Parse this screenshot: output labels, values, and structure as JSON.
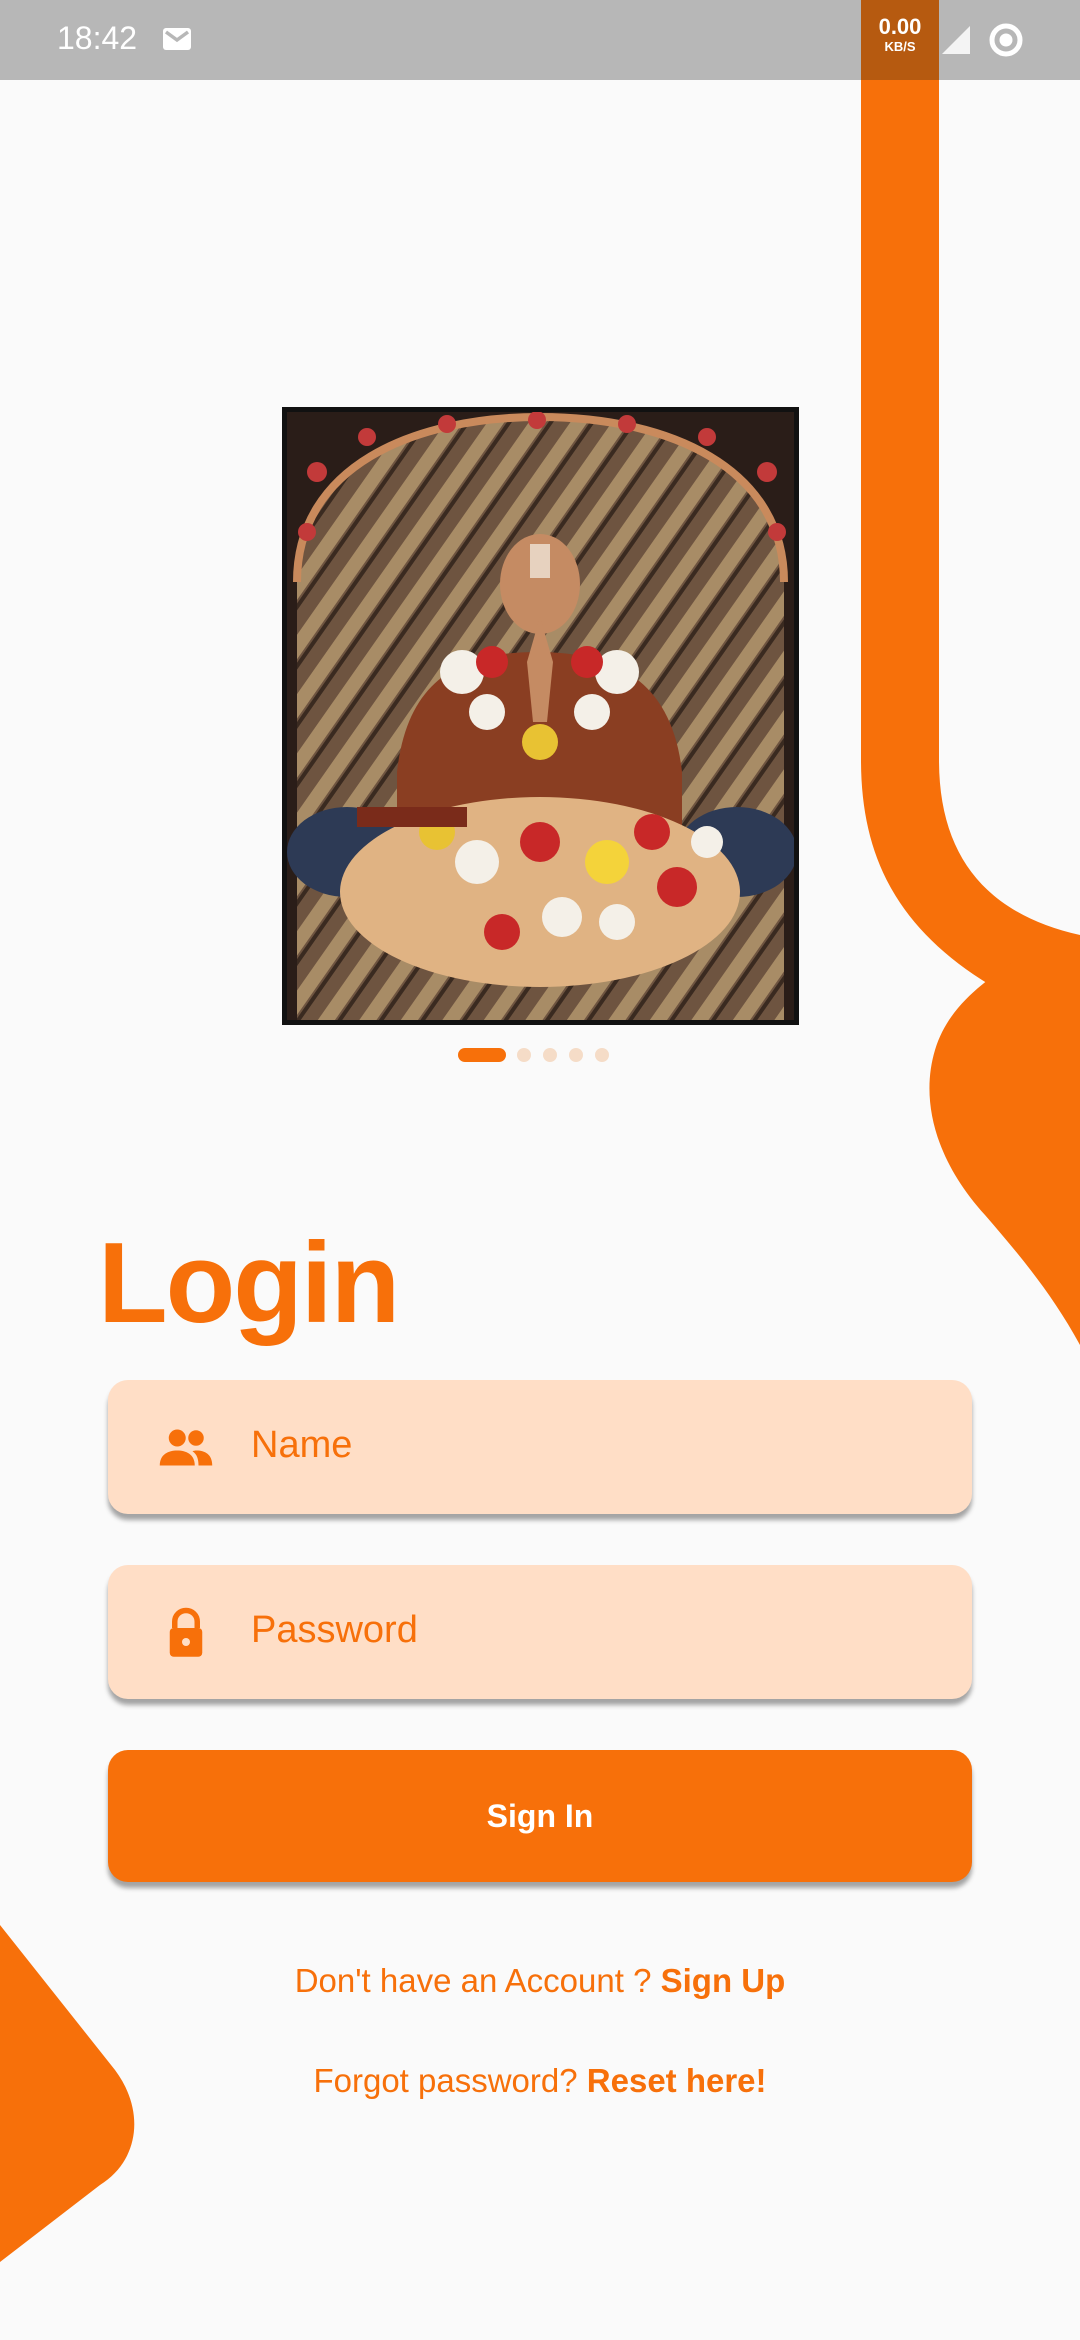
{
  "status_bar": {
    "time": "18:42",
    "net_speed": "0.00",
    "net_unit": "KB/S",
    "icons": [
      "mail-icon",
      "signal-icon",
      "record-icon"
    ]
  },
  "carousel": {
    "image_alt": "Srila Prabhupada seated with flower garlands",
    "page_count": 5,
    "active_index": 0
  },
  "login": {
    "title": "Login",
    "name_placeholder": "Name",
    "name_icon": "people-icon",
    "password_placeholder": "Password",
    "password_icon": "lock-icon",
    "sign_in_label": "Sign In",
    "signup_prompt": "Don't have an Account ? ",
    "signup_link": "Sign Up",
    "forgot_prompt": "Forgot password? ",
    "reset_link": "Reset here!"
  },
  "colors": {
    "accent": "#f7700a",
    "field_bg": "#ffdec6",
    "background": "#fafafa",
    "status_bar": "#b7b7b7"
  }
}
